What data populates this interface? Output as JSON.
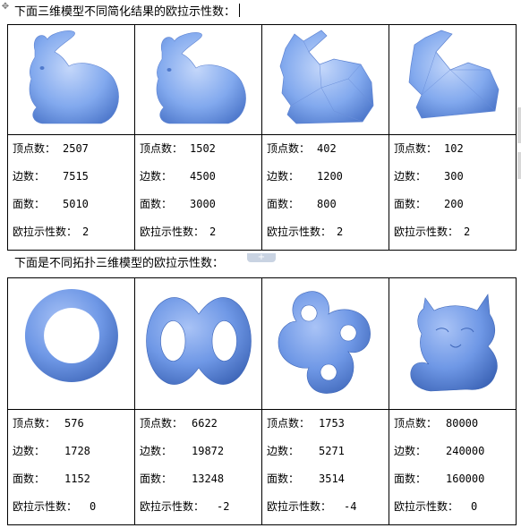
{
  "heading1": "下面三维模型不同简化结果的欧拉示性数：",
  "heading2": "下面是不同拓扑三维模型的欧拉示性数：",
  "labels": {
    "vertices": "顶点数：",
    "edges": "边数：",
    "faces": "面数：",
    "euler": "欧拉示性数："
  },
  "table1": [
    {
      "model": "bunny-icon",
      "vertices": "2507",
      "edges": "7515",
      "faces": "5010",
      "euler": "2"
    },
    {
      "model": "bunny-icon",
      "vertices": "1502",
      "edges": "4500",
      "faces": "3000",
      "euler": "2"
    },
    {
      "model": "bunny-icon",
      "vertices": "402",
      "edges": "1200",
      "faces": "800",
      "euler": "2"
    },
    {
      "model": "bunny-icon",
      "vertices": "102",
      "edges": "300",
      "faces": "200",
      "euler": "2"
    }
  ],
  "table2": [
    {
      "model": "torus-icon",
      "vertices": "576",
      "edges": "1728",
      "faces": "1152",
      "euler": "0"
    },
    {
      "model": "double-torus-icon",
      "vertices": "6622",
      "edges": "19872",
      "faces": "13248",
      "euler": "-2"
    },
    {
      "model": "triple-torus-icon",
      "vertices": "1753",
      "edges": "5271",
      "faces": "3514",
      "euler": "-4"
    },
    {
      "model": "kitten-icon",
      "vertices": "80000",
      "edges": "240000",
      "faces": "160000",
      "euler": "0"
    }
  ],
  "colors": {
    "model_fill": "#7fa7ee",
    "model_light": "#b9cff7",
    "model_dark": "#4f79cc",
    "border": "#000000"
  },
  "icons": [
    "move-handle-icon"
  ]
}
